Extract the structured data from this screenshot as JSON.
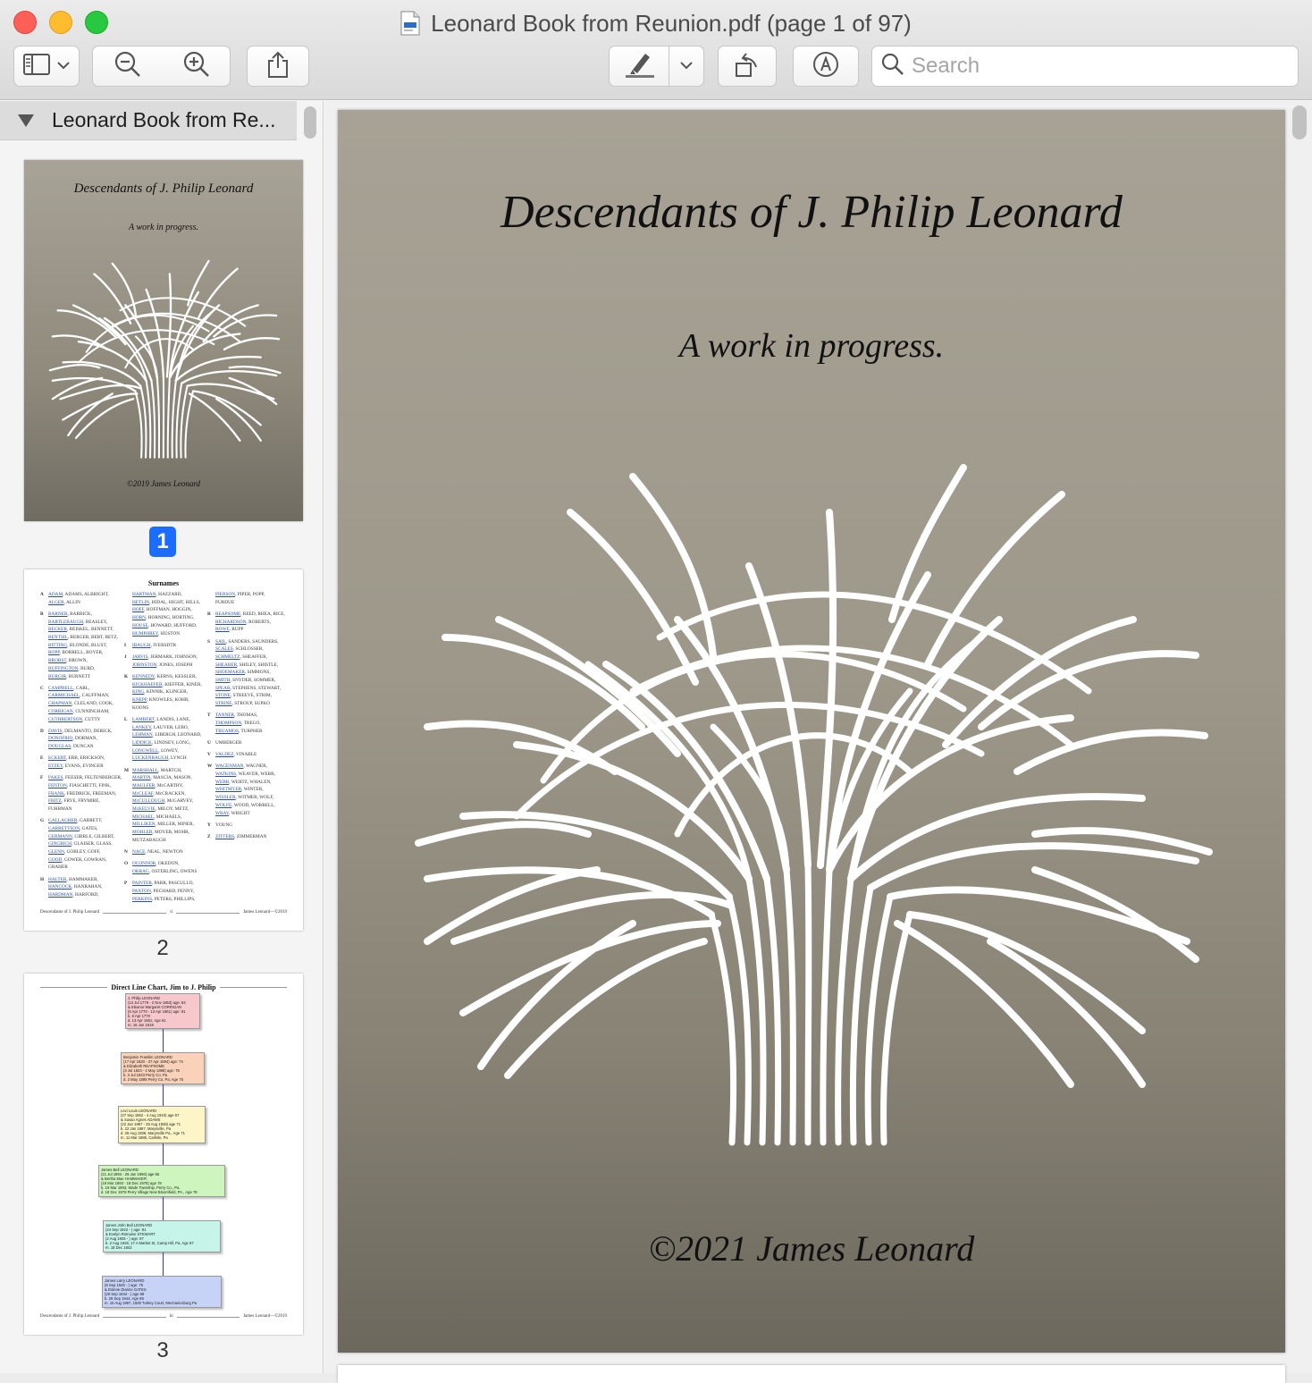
{
  "window": {
    "title": "Leonard Book from Reunion.pdf (page 1 of 97)"
  },
  "toolbar": {
    "search_placeholder": "Search",
    "icons": [
      "sidebar-icon",
      "chevron-down-icon",
      "zoom-out-icon",
      "zoom-in-icon",
      "share-icon",
      "highlighter-icon",
      "rotate-icon",
      "markup-icon",
      "search-icon"
    ]
  },
  "sidebar": {
    "doc_name": "Leonard Book from Re...",
    "pages": [
      {
        "number": "1",
        "selected": true
      },
      {
        "number": "2",
        "selected": false
      },
      {
        "number": "3",
        "selected": false
      }
    ]
  },
  "thumb1": {
    "title": "Descendants of J. Philip Leonard",
    "subtitle": "A work in progress.",
    "copyright": "©2019 James Leonard"
  },
  "thumb2": {
    "heading": "Surnames",
    "col1": [
      [
        "A",
        "ADAM, ADAMS, ALBRIGHT,",
        "ALGER, ALLIN"
      ],
      [
        "B",
        "BARNER, BARRICK,",
        "BARTLEBAUGH, BEASLEY,",
        "BECKER, BEISKEL, BENNETT,",
        "BENTSIL, BERGER, BERT, BETZ,",
        "BITTING, BLONDE, BLUST,",
        "BOPP, BORRELL, BOYER,",
        "BROBST, BROWN,",
        "BUFFINGTON, BURD,",
        "BURGIR, BURNETT"
      ],
      [
        "C",
        "CAMPBELL, CARL,",
        "CARMICHAEL, CAUFFMAN,",
        "CHAPMAN, CLELAND, COOK,",
        "CORRIGAN, CUNNINGHAM,",
        "CUTHBERTSON, CUTTY"
      ],
      [
        "D",
        "DAVIS, DELMANTO, DERICK,",
        "DONOFRIO, DORMAN,",
        "DOUGLAS, DUNCAN"
      ],
      [
        "E",
        "ECKERT, ERB, ERICKSON,",
        "ETZEY, EVANS, EVINGER"
      ],
      [
        "F",
        "FAKES, FEESER, FELTENBERGER,",
        "FENTON, FIASCHETTI, FINK,",
        "FRANK, FREDRICK, FREEMAN,",
        "FRITZ, FRYE, FRYMIRE,",
        "FUHRMAN"
      ],
      [
        "G",
        "GALLAGHER, GARRETT,",
        "GARRETTSON, GATES,",
        "GERMANN, GIBBLE, GILBERT,",
        "GINGRICH, GLAISER, GLASS,",
        "GLENN, GOBLEY, GOFF,",
        "GOOD, GOWER, GOWRAN,",
        "GRAHER"
      ],
      [
        "H",
        "HALTER, HAMMAKER,",
        "HANCOCK, HANRAHAN,",
        "HARDMAN, HARFORD,"
      ]
    ],
    "col2": [
      [
        "",
        "HARTMAN, HAZZARD,",
        "HETLIN, HIDAL, HIGHT, HILLS,",
        "HOFF, HOFFMAN, HOGGIN,",
        "HORN, HORNING, HORTING,",
        "HOUSE, HOWARD, HUFFORD,",
        "HUMPHREY, HUSTON"
      ],
      [
        "I",
        "IBAUGH, IVERSDTR"
      ],
      [
        "J",
        "JARVIS, JERMARK, JOHNSON,",
        "JOHNSTON, JONES, JOSEPH"
      ],
      [
        "K",
        "KENNEDY, KERNS, KESSLER,",
        "KICKHAEFER, KIEFFER, KINER,",
        "KING, KINNIK, KLINGER,",
        "KNEPP, KNOWLES, KOHR,",
        "KOONS"
      ],
      [
        "L",
        "LAMBERT, LANDIS, LANE,",
        "LANKEY, LAUVER, LEBO,",
        "LEHMAN, LIBERGH, LEONARD,",
        "LIDDICK, LINDSEY, LONG,",
        "LONGWELL, LOWEY,",
        "LUCKENBAUGH, LYNCH"
      ],
      [
        "M",
        "MARSHALL, MARTCH,",
        "MARTIN, MASCIA, MASON,",
        "MAULFER, McCARTHY,",
        "McCLEAF, McCRACKEN,",
        "McCULLOUGH, McGARVEY,",
        "McKELVIE, MILOY, METZ,",
        "MICHAEL, MICHAELS,",
        "MILLIKEN, MILLER, MINER,",
        "MOHLER, MOYER, MOHR,",
        "MUTZABAUGH"
      ],
      [
        "N",
        "NACE, NEAL, NEWTON"
      ],
      [
        "O",
        "OCONNOR, OKEDON,",
        "OKRAG, OSTERLING, OWENS"
      ],
      [
        "P",
        "PAINTER, PARR, PASCULLO,",
        "PAXTON, PECHARD, PENNY,",
        "PERKINS, PETERS, PHILLIPS,"
      ]
    ],
    "col3": [
      [
        "",
        "PIERSON, PIPER, POPP,",
        "PURDUE"
      ],
      [
        "R",
        "REAPSOME, REED, RHEA, RICE,",
        "RICHARDSON, ROBERTS,",
        "ROWE, RUPP"
      ],
      [
        "S",
        "SAIL, SANDERS, SAUNDERS,",
        "SCALES, SCHLOSSER,",
        "SCHMELTZ, SHEAFFER,",
        "SHEARER, SHILEY, SHISTLE,",
        "SHOEMAKER, SIMMONS,",
        "SMITH, SNYDER, SOMMER,",
        "SPEAR, STEPHENS, STEWART,",
        "STONE, STREEVE, STRIM,",
        "STRINE, STROUP, SUPKO"
      ],
      [
        "T",
        "TANNER, THOMAS,",
        "THOMPSON, TREGO,",
        "TRUAMOS, TURPHER"
      ],
      [
        "U",
        "UMBERGER"
      ],
      [
        "V",
        "VALDEZ, VINABLE"
      ],
      [
        "W",
        "WAGENMAN, WAGNER,",
        "WATKINS, WEAVER, WEBB,",
        "WEBB, WERTZ, WHALEN,",
        "WHITMYER, WINTER,",
        "WISSLER, WITMER, WOLF,",
        "WOLFE, WOOD, WORRELL,",
        "WRAY, WRIGHT"
      ],
      [
        "Y",
        "YOUNG"
      ],
      [
        "Z",
        "ZITTERS, ZIMMERMAN"
      ]
    ],
    "footer_left": "Descendants of J. Philip Leonard",
    "footer_mid": "ii",
    "footer_right": "James Leonard—©2019"
  },
  "thumb3": {
    "heading": "Direct Line Chart, Jim to J. Philip",
    "boxes": [
      {
        "color": "#f6c7cb",
        "lines": [
          "J. Philip LEONARD",
          "(13 Jul 1779 - 2 Nov 1853) age: 84",
          "& Eleanor Margaret CORRIGAN",
          "(6 Apr 1770 - 13 Apr 1861) age: 91",
          "b. 6 Apr 1770",
          "d. 13 Apr 1861, Age 91",
          "m. 16 Jun 1819"
        ]
      },
      {
        "color": "#f9d2b9",
        "lines": [
          "Benjamin Franklin LEONARD",
          "(17 Apr 1820 - 27 Apr 1894) age: 74",
          "& Elizabeth REAPSOME",
          "(3 Jul 1823 - 2 May 1898) age: 75",
          "b. 3 Jul 1823 Perry Co. Pa",
          "d. 2 May 1898 Perry Co. Pa, Age 75"
        ]
      },
      {
        "color": "#fbf5c8",
        "lines": [
          "Levi Louis LEONARD",
          "(27 Sep 1852 - 4 Aug 1910) age 57",
          "& Susan Agnes ADAMS",
          "(22 Jan 1867 - 25 Aug 1938) age 71",
          "b. 22 Jan 1867, Marysville, Pa",
          "d. 25 Aug 1938, Marysville Pa., Age 71",
          "m. 11 Mar 1886, Carlisle, Pa"
        ]
      },
      {
        "color": "#cdf5bd",
        "lines": [
          "James Bell LEONARD",
          "(21 Jul 1894 - 26 Jan 1960) age 65",
          "& Bertha Mae HAMMAKER",
          "(19 Mar 1893 - 18 Dec 1978) age 78",
          "b. 19 Mar 1893, Wade Township, Perry Co., Pa.",
          "d. 18 Dec 1978 Perry Village New Bloomfield, PA., Age 78"
        ]
      },
      {
        "color": "#c6f4e8",
        "lines": [
          "James John Bell LEONARD",
          "(24 Sep 1922 - ) age: 91",
          "& Evelyn Romaine STEWART",
          "(2 Aug 1926 - ) age: 87",
          "b. 2 Aug 1926, 17 A Market St, Camp Hill, Pa, Age 87",
          "m. 18 Dec 1942"
        ]
      },
      {
        "color": "#c7d3f6",
        "lines": [
          "James Larry LEONARD",
          "(8 Sep 1946 - ) age: 75",
          "& Dolene Dianne GATES",
          "(29 Sep 1944 - ) age 69",
          "b. 29 Sep 1944, Age 69",
          "m. 15 Aug 1997, 1500 Turkey Court, Mechanicsburg Pa"
        ]
      }
    ],
    "footer_left": "Descendants of J. Philip Leonard",
    "footer_mid": "iii",
    "footer_right": "James Leonard—©2019"
  },
  "page": {
    "title": "Descendants of J. Philip Leonard",
    "subtitle": "A work in progress.",
    "copyright": "©2021 James Leonard"
  }
}
